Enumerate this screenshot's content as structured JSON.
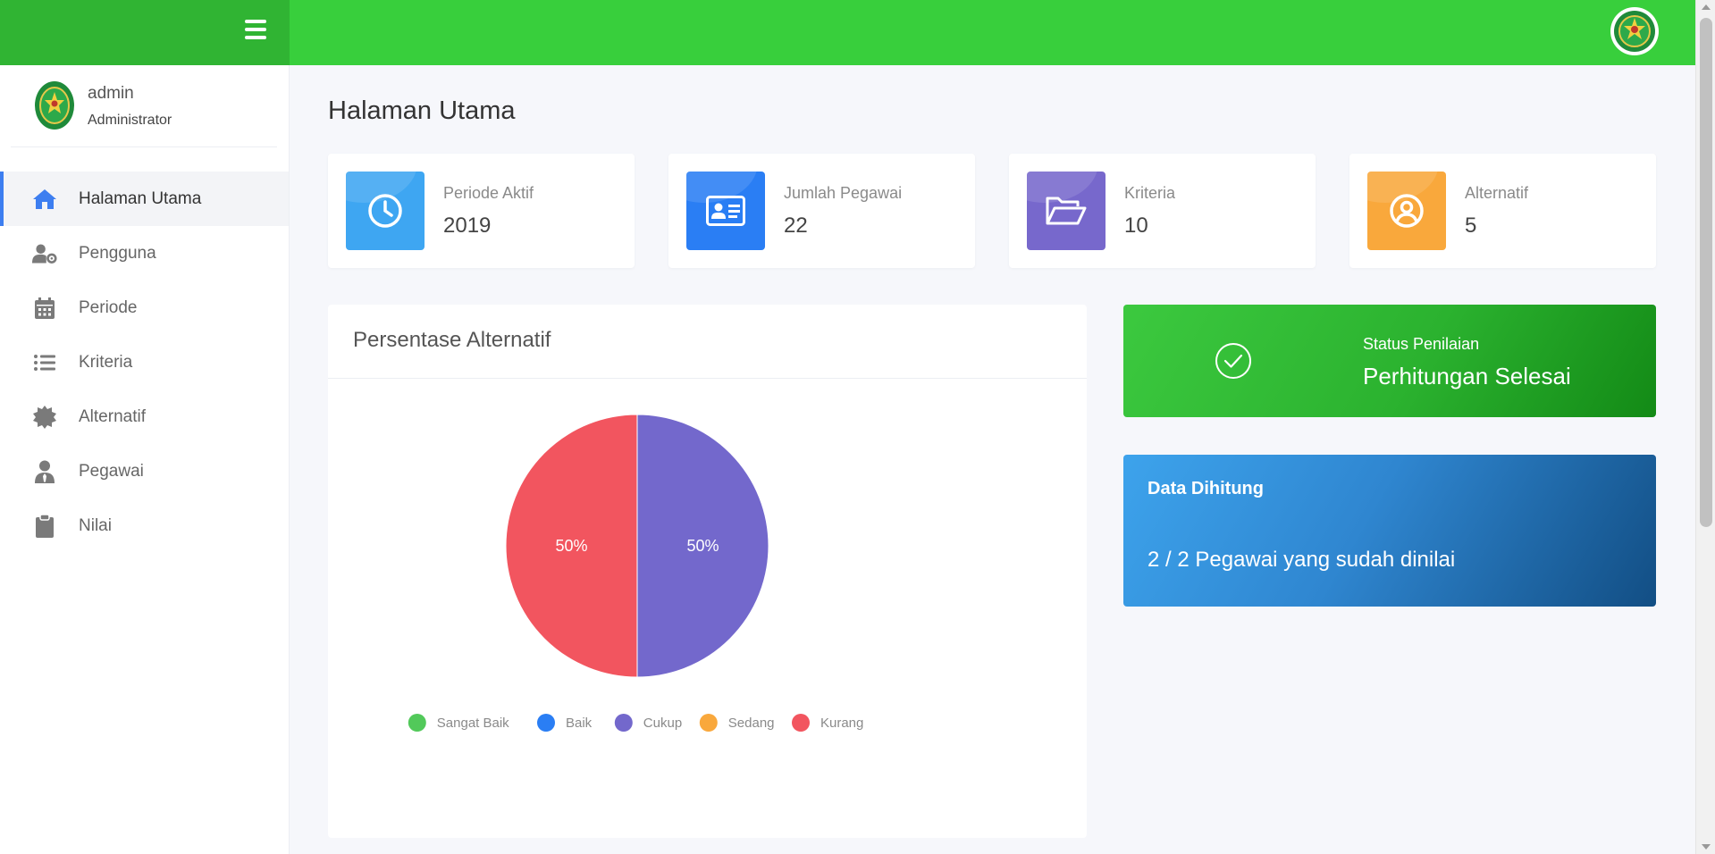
{
  "header": {
    "menu_icon": "hamburger-icon",
    "logo_icon": "court-emblem-icon",
    "color": "#38cf3c",
    "brand_color": "#30b433"
  },
  "user": {
    "name": "admin",
    "role": "Administrator",
    "avatar_icon": "court-emblem-icon"
  },
  "sidebar": {
    "items": [
      {
        "label": "Halaman Utama",
        "icon": "home-icon",
        "active": true
      },
      {
        "label": "Pengguna",
        "icon": "user-gear-icon"
      },
      {
        "label": "Periode",
        "icon": "calendar-icon"
      },
      {
        "label": "Kriteria",
        "icon": "list-icon"
      },
      {
        "label": "Alternatif",
        "icon": "badge-icon"
      },
      {
        "label": "Pegawai",
        "icon": "user-tie-icon"
      },
      {
        "label": "Nilai",
        "icon": "clipboard-icon"
      }
    ]
  },
  "page": {
    "title": "Halaman Utama"
  },
  "stats": [
    {
      "label": "Periode Aktif",
      "value": "2019",
      "icon": "clock-icon",
      "color": "#3ea6f2"
    },
    {
      "label": "Jumlah Pegawai",
      "value": "22",
      "icon": "id-card-icon",
      "color": "#2a7ef4"
    },
    {
      "label": "Kriteria",
      "value": "10",
      "icon": "folder-open-icon",
      "color": "#7768cc"
    },
    {
      "label": "Alternatif",
      "value": "5",
      "icon": "user-circle-icon",
      "color": "#f9a83c"
    }
  ],
  "chart_card": {
    "title": "Persentase Alternatif"
  },
  "chart_data": {
    "type": "pie",
    "categories": [
      "Sangat Baik",
      "Baik",
      "Cukup",
      "Sedang",
      "Kurang"
    ],
    "values": [
      0,
      0,
      50,
      0,
      50
    ],
    "data_labels": [
      "",
      "",
      "50%",
      "",
      "50%"
    ],
    "colors": [
      "#52c95a",
      "#2a7ef4",
      "#7368cc",
      "#f9a83c",
      "#f2555f"
    ],
    "legend": "bottom"
  },
  "status": {
    "label": "Status Penilaian",
    "value": "Perhitungan Selesai",
    "icon": "check-circle-icon"
  },
  "data_card": {
    "title": "Data Dihitung",
    "value": "2 / 2 Pegawai yang sudah dinilai"
  }
}
